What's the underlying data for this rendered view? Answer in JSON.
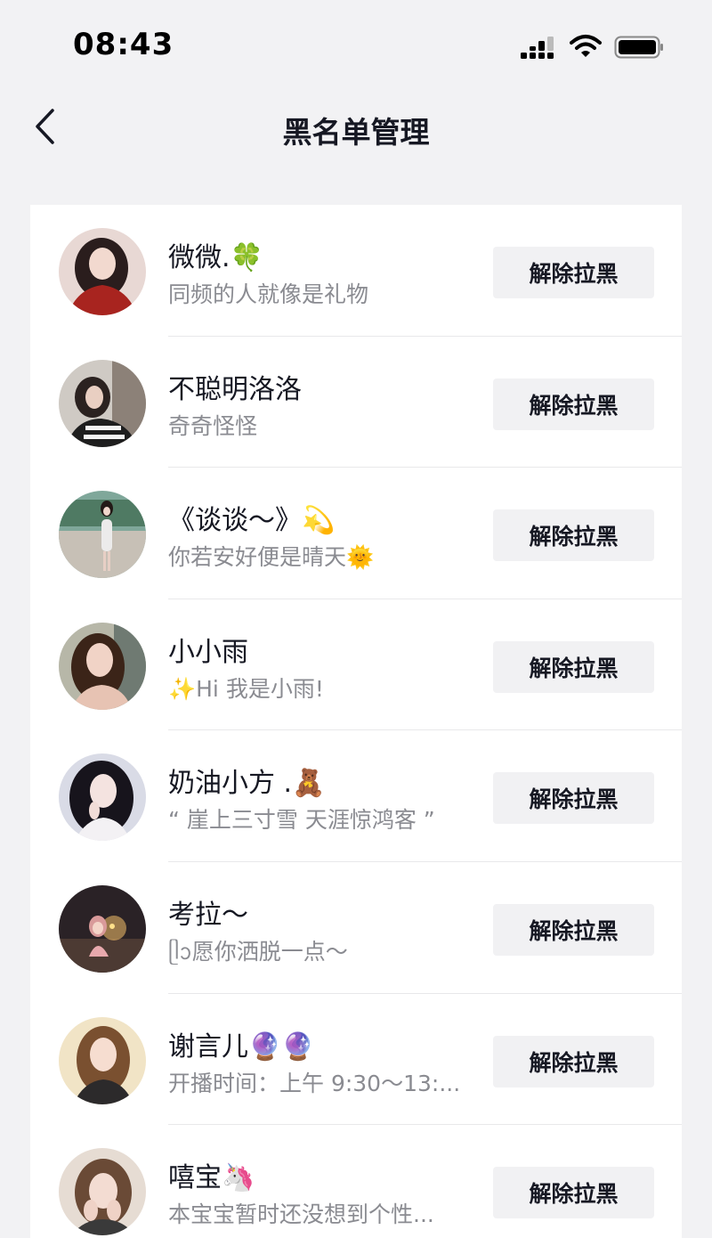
{
  "status_bar": {
    "time": "08:43"
  },
  "nav": {
    "title": "黑名单管理"
  },
  "unblock_label": "解除拉黑",
  "users": [
    {
      "name": "微微.🍀",
      "signature": "同频的人就像是礼物"
    },
    {
      "name": "不聪明洛洛",
      "signature": "奇奇怪怪"
    },
    {
      "name": "《谈谈～》💫",
      "signature": "你若安好便是晴天🌞"
    },
    {
      "name": "小小雨",
      "signature": "✨Hi 我是小雨!"
    },
    {
      "name": "奶油小方 .🧸",
      "signature": "“ 崖上三寸雪 天涯惊鸿客 ”"
    },
    {
      "name": "考拉～",
      "signature": "ᥫᩣ愿你洒脱一点～"
    },
    {
      "name": "谢言儿🔮🔮",
      "signature": "开播时间：上午 9:30～13:..."
    },
    {
      "name": "嘻宝🦄",
      "signature": "本宝宝暂时还没想到个性..."
    }
  ]
}
